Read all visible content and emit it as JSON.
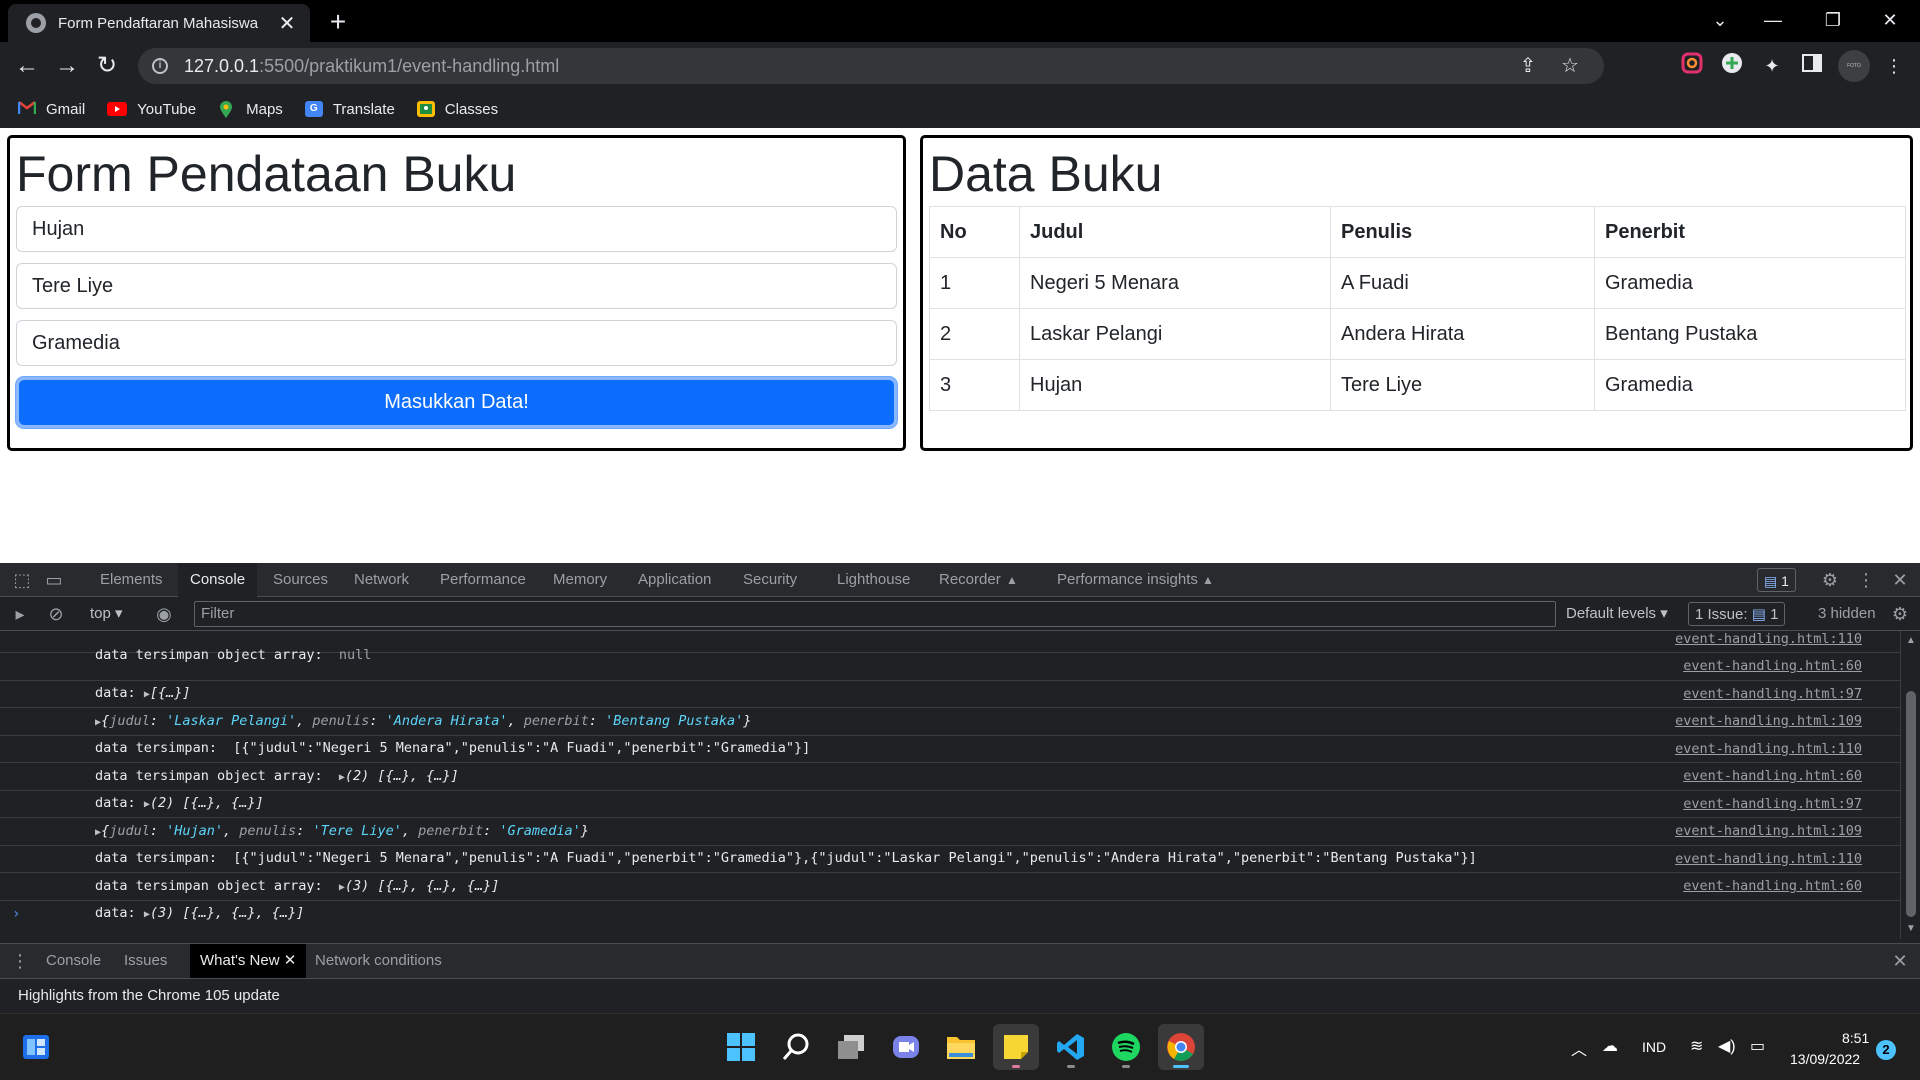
{
  "browser": {
    "tab_title": "Form Pendaftaran Mahasiswa",
    "tab_close": "✕",
    "new_tab": "+",
    "url_host": "127.0.0.1",
    "url_path": ":5500/praktikum1/event-handling.html",
    "bookmarks": [
      {
        "label": "Gmail",
        "icon": "gmail-icon",
        "color": "#ea4335"
      },
      {
        "label": "YouTube",
        "icon": "youtube-icon",
        "color": "#ff0000"
      },
      {
        "label": "Maps",
        "icon": "maps-icon",
        "color": "#34a853"
      },
      {
        "label": "Translate",
        "icon": "translate-icon",
        "color": "#4285f4"
      },
      {
        "label": "Classes",
        "icon": "classes-icon",
        "color": "#fbbc04"
      }
    ],
    "profile_label": "FOTO PROFIL"
  },
  "form": {
    "heading": "Form Pendataan Buku",
    "judul_value": "Hujan",
    "penulis_value": "Tere Liye",
    "penerbit_value": "Gramedia",
    "submit_label": "Masukkan Data!"
  },
  "table": {
    "heading": "Data Buku",
    "headers": [
      "No",
      "Judul",
      "Penulis",
      "Penerbit"
    ],
    "rows": [
      [
        "1",
        "Negeri 5 Menara",
        "A Fuadi",
        "Gramedia"
      ],
      [
        "2",
        "Laskar Pelangi",
        "Andera Hirata",
        "Bentang Pustaka"
      ],
      [
        "3",
        "Hujan",
        "Tere Liye",
        "Gramedia"
      ]
    ]
  },
  "devtools": {
    "tabs": [
      "Elements",
      "Console",
      "Sources",
      "Network",
      "Performance",
      "Memory",
      "Application",
      "Security",
      "Lighthouse",
      "Recorder",
      "Performance insights"
    ],
    "active_tab": "Console",
    "message_badge": "1",
    "context": "top",
    "filter_placeholder": "Filter",
    "default_levels": "Default levels",
    "issues_label": "1 Issue:",
    "issues_count": "1",
    "hidden_label": "3 hidden",
    "console_lines": [
      {
        "text": "data tersimpan object array:  ",
        "extra": "null",
        "src": "event-handling.html:110"
      },
      {
        "text": "data: ",
        "extra": "[{…}]",
        "src": "event-handling.html:60"
      },
      {
        "text": "{judul: 'Laskar Pelangi', penulis: 'Andera Hirata', penerbit: 'Bentang Pustaka'}",
        "extra": "",
        "src": "event-handling.html:97"
      },
      {
        "text": "data tersimpan:  [{\"judul\":\"Negeri 5 Menara\",\"penulis\":\"A Fuadi\",\"penerbit\":\"Gramedia\"}]",
        "extra": "",
        "src": "event-handling.html:109"
      },
      {
        "text": "data tersimpan object array:  ",
        "extra": "(2) [{…}, {…}]",
        "src": "event-handling.html:110"
      },
      {
        "text": "data: ",
        "extra": "(2) [{…}, {…}]",
        "src": "event-handling.html:60"
      },
      {
        "text": "{judul: 'Hujan', penulis: 'Tere Liye', penerbit: 'Gramedia'}",
        "extra": "",
        "src": "event-handling.html:97"
      },
      {
        "text": "data tersimpan:  [{\"judul\":\"Negeri 5 Menara\",\"penulis\":\"A Fuadi\",\"penerbit\":\"Gramedia\"},{\"judul\":\"Laskar Pelangi\",\"penulis\":\"Andera Hirata\",\"penerbit\":\"Bentang Pustaka\"}]",
        "extra": "",
        "src": "event-handling.html:109"
      },
      {
        "text": "data tersimpan object array:  ",
        "extra": "(3) [{…}, {…}, {…}]",
        "src": "event-handling.html:110"
      },
      {
        "text": "data: ",
        "extra": "(3) [{…}, {…}, {…}]",
        "src": "event-handling.html:60"
      }
    ],
    "drawer_tabs": [
      "Console",
      "Issues",
      "What's New",
      "Network conditions"
    ],
    "drawer_active": "What's New",
    "whats_new_text": "Highlights from the Chrome 105 update"
  },
  "taskbar": {
    "language": "IND",
    "time": "8:51",
    "date": "13/09/2022",
    "notification_count": "2"
  }
}
